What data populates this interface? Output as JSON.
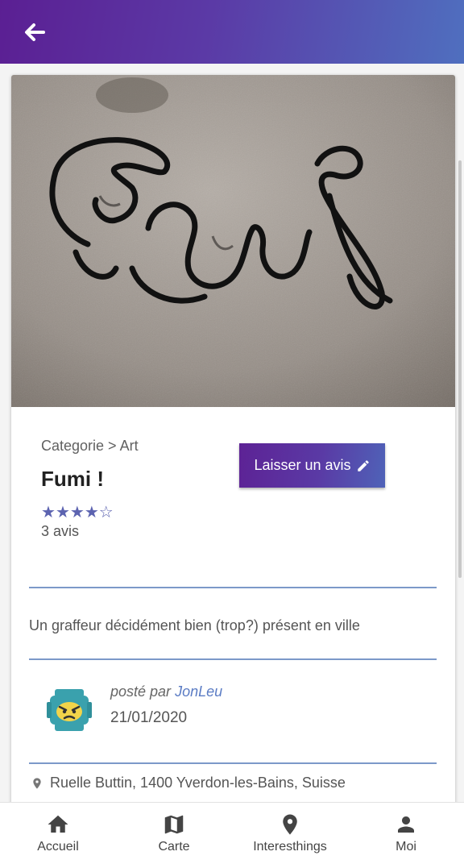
{
  "appbar": {
    "back_icon": "arrow-left-icon"
  },
  "place": {
    "category": "Categorie > Art",
    "title": "Fumi !",
    "rating": 4,
    "rating_max": 5,
    "reviews": "3 avis",
    "review_button": "Laisser un avis",
    "description": "Un graffeur décidément bien (trop?) présent en ville",
    "posted_by_prefix": "posté par",
    "author": "JonLeu",
    "date": "21/01/2020",
    "address": "Ruelle Buttin, 1400 Yverdon-les-Bains, Suisse"
  },
  "nav": {
    "items": [
      {
        "label": "Accueil",
        "icon": "home-icon"
      },
      {
        "label": "Carte",
        "icon": "map-icon"
      },
      {
        "label": "Interesthings",
        "icon": "location-pin-icon"
      },
      {
        "label": "Moi",
        "icon": "person-icon"
      }
    ]
  },
  "colors": {
    "accent": "#5b3aa6",
    "star": "#5c63b0",
    "link": "#5b7cc4"
  }
}
